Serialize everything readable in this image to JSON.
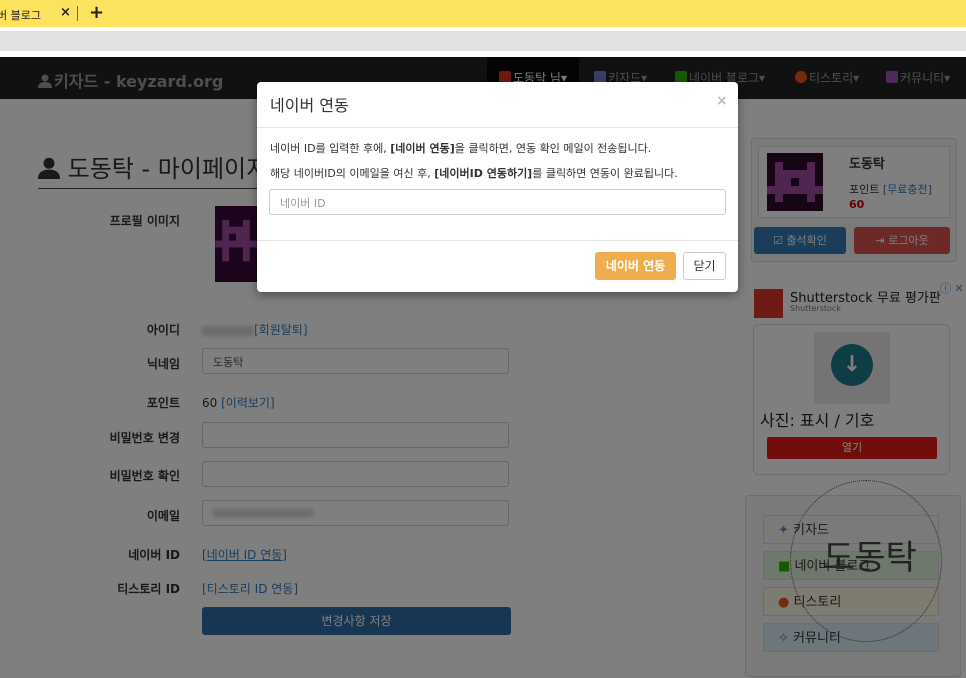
{
  "browser": {
    "tab_title": "버 블로그",
    "tab_close": "×",
    "new_tab": "+"
  },
  "navbar": {
    "brand": "키자드 - keyzard.org",
    "items": [
      {
        "label": "도동탁 님▾",
        "color": "#e0352b"
      },
      {
        "label": "키자드▾",
        "color": "#6a7fd0"
      },
      {
        "label": "네이버 블로그▾",
        "color": "#2db400"
      },
      {
        "label": "티스토리▾",
        "color": "#e8541b"
      },
      {
        "label": "커뮤니티▾",
        "color": "#9b59b6"
      }
    ]
  },
  "profile": {
    "title": "도동탁 - 마이페이지",
    "labels": {
      "image": "프로필 이미지",
      "id": "아이디",
      "nickname": "닉네임",
      "points": "포인트",
      "pw_change": "비밀번호 변경",
      "pw_confirm": "비밀번호 확인",
      "email": "이메일",
      "naver_id": "네이버 ID",
      "tistory_id": "티스토리 ID"
    },
    "id_link": "[회원탈퇴]",
    "nickname_value": "도동탁",
    "points_value": "60",
    "points_link": "[이력보기]",
    "naver_link": "[네이버 ID 연동]",
    "tistory_link": "[티스토리 ID 연동]",
    "save_button": "변경사항 저장"
  },
  "sidebar": {
    "name": "도동탁",
    "points_label": "포인트",
    "points_link": "[무료충전]",
    "points_value": "60",
    "checkin_button": "출석확인",
    "logout_button": "로그아웃"
  },
  "ad": {
    "title": "Shutterstock 무료 평가판",
    "subtitle": "Shutterstock",
    "caption": "사진: 표시 / 기호",
    "open_button": "열기"
  },
  "menu": {
    "items": [
      {
        "label": "키자드",
        "bg": "#f5f5f5"
      },
      {
        "label": "네이버 블로그",
        "bg": "#dff0d8"
      },
      {
        "label": "티스토리",
        "bg": "#fcf8e3"
      },
      {
        "label": "커뮤니티",
        "bg": "#d9edf7"
      }
    ],
    "stamp": "도동탁"
  },
  "modal": {
    "title": "네이버 연동",
    "close": "×",
    "line1_pre": "네이버 ID를 입력한 후에, ",
    "line1_bold": "[네이버 연동]",
    "line1_post": "을 클릭하면, 연동 확인 메일이 전송됩니다.",
    "line2_pre": "해당 네이버ID의 이메일을 여신 후, ",
    "line2_bold": "[네이버ID 연동하기]",
    "line2_post": "를 클릭하면 연동이 완료됩니다.",
    "input_placeholder": "네이버 ID",
    "primary_button": "네이버 연동",
    "close_button": "닫기"
  }
}
